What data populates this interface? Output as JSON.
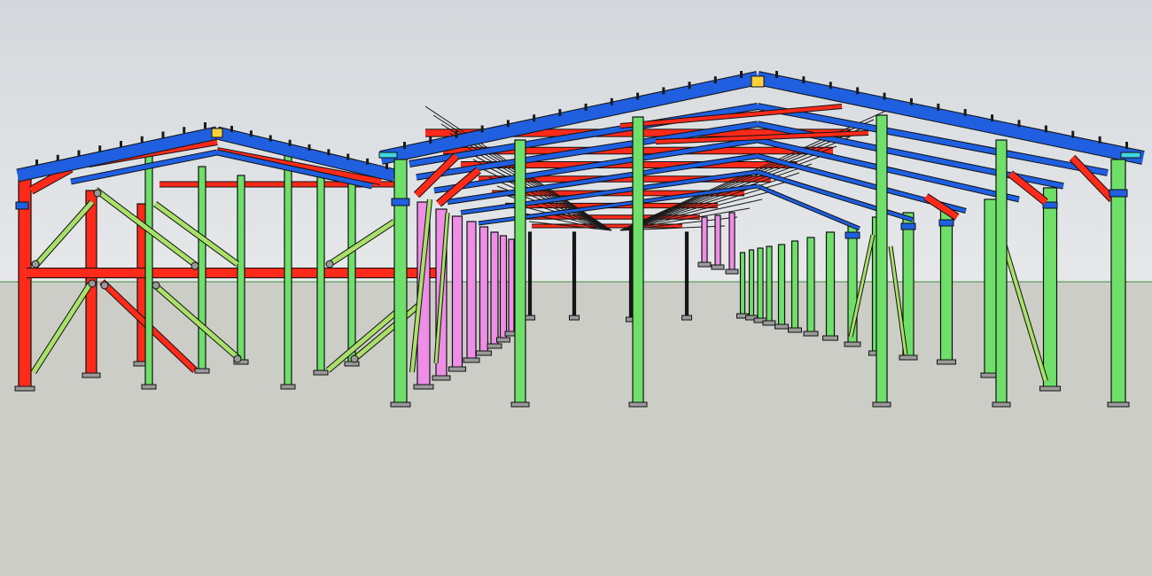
{
  "scene": {
    "subject": "steel-frame-warehouse-model",
    "colors": {
      "sky_top": "#d4d8dc",
      "sky_bottom": "#e6e8ea",
      "ground": "#cdcdc8",
      "horizon_line": "#3c8f3c",
      "rafter": "#1f5fe0",
      "purlin": "#1a1a1a",
      "column": "#6ee06a",
      "bracing": "#a9e06a",
      "frame_red": "#ff2a1a",
      "column_pink": "#ee8ee6",
      "outline": "#111111",
      "base_plate": "#9a9a9a",
      "cyan_bracket": "#3fd6e0",
      "yellow_detail": "#ffd23a"
    }
  }
}
